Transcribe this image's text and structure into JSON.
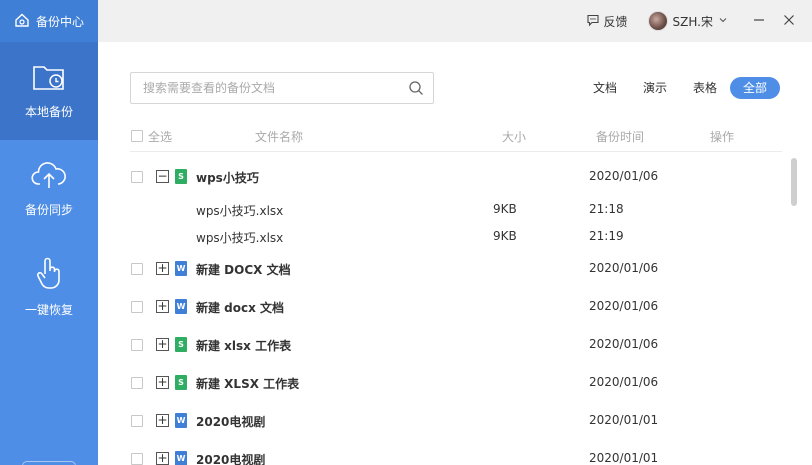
{
  "app": {
    "title": "备份中心"
  },
  "header": {
    "feedback": "反馈",
    "username": "SZH.宋"
  },
  "sidebar": {
    "items": [
      {
        "label": "本地备份",
        "icon": "folder-clock-icon",
        "active": true
      },
      {
        "label": "备份同步",
        "icon": "cloud-upload-icon",
        "active": false
      },
      {
        "label": "一键恢复",
        "icon": "hand-pointer-icon",
        "active": false
      }
    ]
  },
  "search": {
    "placeholder": "搜索需要查看的备份文档",
    "value": ""
  },
  "filters": [
    "文档",
    "演示",
    "表格",
    "全部"
  ],
  "active_filter": "全部",
  "table": {
    "select_all": "全选",
    "columns": {
      "name": "文件名称",
      "size": "大小",
      "time": "备份时间",
      "action": "操作"
    },
    "rows": [
      {
        "name": "wps小技巧",
        "type": "xlsx",
        "date": "2020/01/06",
        "expanded": true,
        "children": [
          {
            "name": "wps小技巧.xlsx",
            "size": "9KB",
            "time": "21:18"
          },
          {
            "name": "wps小技巧.xlsx",
            "size": "9KB",
            "time": "21:19"
          }
        ]
      },
      {
        "name": "新建 DOCX 文档",
        "type": "docx",
        "date": "2020/01/06",
        "expanded": false
      },
      {
        "name": "新建 docx 文档",
        "type": "docx",
        "date": "2020/01/06",
        "expanded": false
      },
      {
        "name": "新建 xlsx 工作表",
        "type": "xlsx",
        "date": "2020/01/06",
        "expanded": false
      },
      {
        "name": "新建 XLSX 工作表",
        "type": "xlsx",
        "date": "2020/01/06",
        "expanded": false
      },
      {
        "name": "2020电视剧",
        "type": "docx",
        "date": "2020/01/01",
        "expanded": false
      },
      {
        "name": "2020电视剧",
        "type": "docx",
        "date": "2020/01/01",
        "expanded": false
      }
    ]
  },
  "colors": {
    "accent": "#4e8ee6",
    "brand": "#3f7fd6",
    "sidebar_active": "#3b74c9",
    "excel": "#2fae63",
    "word": "#3f7fd6"
  }
}
